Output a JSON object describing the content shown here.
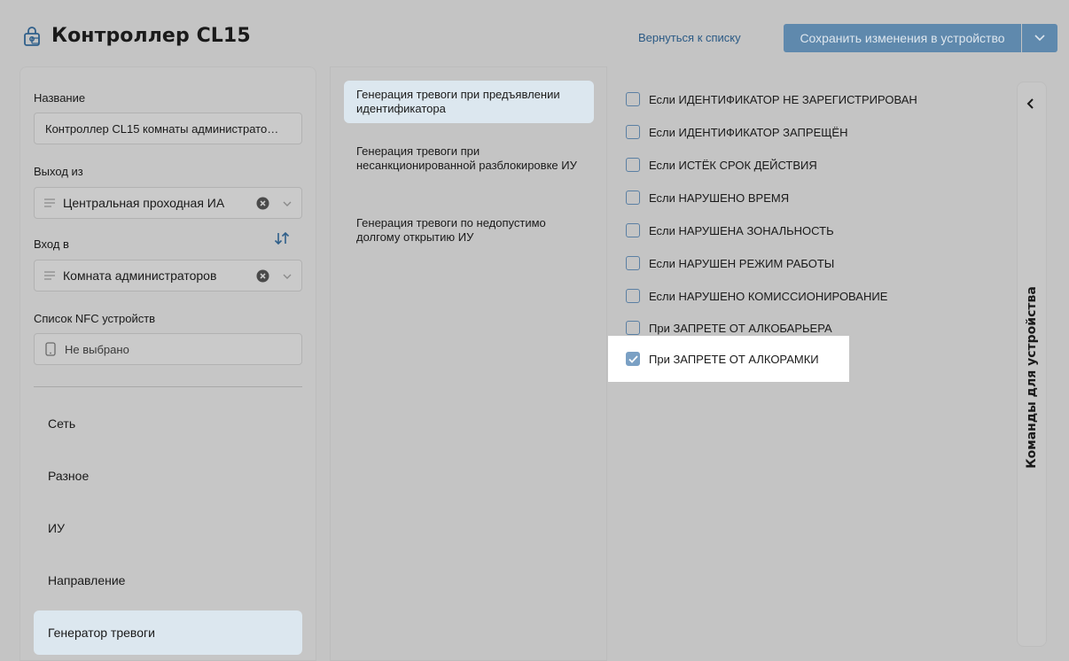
{
  "header": {
    "title": "Контроллер CL15",
    "back_link": "Вернуться к списку",
    "save_button": "Сохранить изменения в устройство"
  },
  "left": {
    "name_label": "Название",
    "name_value": "Контроллер CL15 комнаты администрато…",
    "exit_label": "Выход из",
    "exit_value": "Центральная проходная ИА",
    "entry_label": "Вход в",
    "entry_value": "Комната администраторов",
    "nfc_label": "Список NFC устройств",
    "nfc_placeholder": "Не выбрано",
    "nav": [
      "Сеть",
      "Разное",
      "ИУ",
      "Направление",
      "Генератор тревоги"
    ]
  },
  "alarm_types": [
    "Генерация тревоги при предъявлении идентификатора",
    "Генерация тревоги при несанкционированной разблокировке ИУ",
    "Генерация тревоги по недопустимо долгому открытию ИУ"
  ],
  "conditions": [
    {
      "label": "Если ИДЕНТИФИКАТОР НЕ ЗАРЕГИСТРИРОВАН",
      "checked": false
    },
    {
      "label": "Если ИДЕНТИФИКАТОР ЗАПРЕЩЁН",
      "checked": false
    },
    {
      "label": "Если ИСТЁК СРОК ДЕЙСТВИЯ",
      "checked": false
    },
    {
      "label": "Если НАРУШЕНО ВРЕМЯ",
      "checked": false
    },
    {
      "label": "Если НАРУШЕНА ЗОНАЛЬНОСТЬ",
      "checked": false
    },
    {
      "label": "Если НАРУШЕН РЕЖИМ РАБОТЫ",
      "checked": false
    },
    {
      "label": "Если НАРУШЕНО КОМИССИОНИРОВАНИЕ",
      "checked": false
    },
    {
      "label": "При ЗАПРЕТЕ ОТ АЛКОБАРЬЕРА",
      "checked": false
    },
    {
      "label": "При ЗАПРЕТЕ ОТ АЛКОРАМКИ",
      "checked": true
    }
  ],
  "side_panel": {
    "label": "Команды для устройства"
  },
  "colors": {
    "accent": "#5f89ad",
    "link": "#2b5a85",
    "active_bg": "#dce7ef",
    "background": "#c4c4c4"
  }
}
